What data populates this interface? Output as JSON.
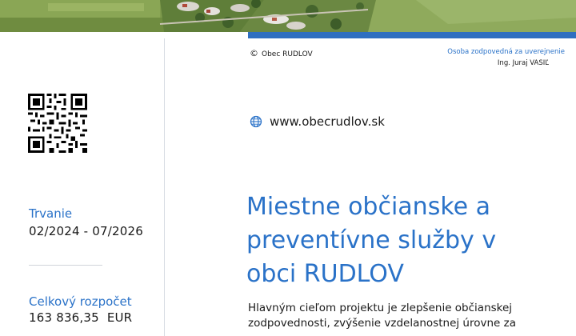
{
  "header": {
    "copyright": "Obec RUDLOV",
    "responsible_label": "Osoba zodpovedná za uverejnenie",
    "responsible_name": "Ing. Juraj VASIĽ"
  },
  "website": "www.obecrudlov.sk",
  "sidebar": {
    "duration_label": "Trvanie",
    "duration_value": "02/2024 - 07/2026",
    "budget_label": "Celkový rozpočet",
    "budget_value": "163 836,35  EUR"
  },
  "title_lines": [
    "Miestne občianske a",
    "preventívne služby v",
    "obci RUDLOV"
  ],
  "body_lines": [
    "Hlavným cieľom projektu je zlepšenie občianskej",
    "zodpovednosti, zvýšenie vzdelanostnej úrovne za"
  ],
  "colors": {
    "accent": "#2a72c8",
    "strip": "#2f6fc0"
  },
  "icons": [
    "copyright-icon",
    "globe-icon",
    "qr-code"
  ]
}
